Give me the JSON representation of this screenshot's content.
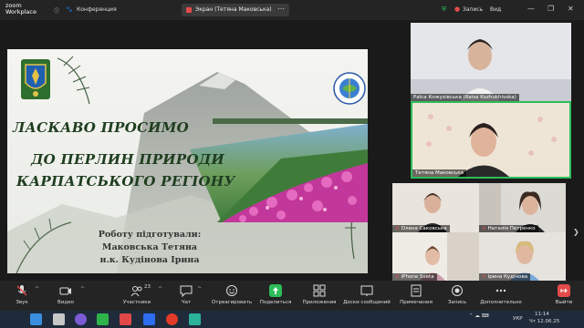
{
  "titlebar": {
    "logo_line1": "zoom",
    "logo_line2": "Workplace",
    "conference_label": "Конференция",
    "share_label": "Экран (Тетяна Маковська)",
    "record_label": "Запись",
    "view_label": "Вид"
  },
  "slide": {
    "title_line1": "ЛАСКАВО ПРОСИМО",
    "title_line2": "ДО ПЕРЛИН ПРИРОДИ",
    "title_line3": "КАРПАТСЬКОГО РЕГІОНУ",
    "prepared_by": "Роботу підготували:",
    "author1": "Маковська Тетяна",
    "author2": "н.к. Кудінова Ірина"
  },
  "participants": [
    {
      "name": "Раїса Кожухівська (Raisa Kozhukhivska)",
      "muted": false
    },
    {
      "name": "Тетяна Маковська",
      "muted": false
    },
    {
      "name": "Олена Саковська",
      "muted": true
    },
    {
      "name": "Наталія Петренко",
      "muted": true
    },
    {
      "name": "iPhone Sveta",
      "muted": true
    },
    {
      "name": "Ірина Кудінова",
      "muted": true
    }
  ],
  "toolbar": {
    "audio": "Звук",
    "video": "Видео",
    "participants": "Участники",
    "participants_count": "23",
    "chat": "Чат",
    "reactions": "Отреагировать",
    "share": "Поделиться",
    "apps": "Приложения",
    "whiteboards": "Доски сообщений",
    "notes": "Примечания",
    "record": "Запись",
    "more": "Дополнительно",
    "leave": "Выйти"
  },
  "taskbar": {
    "time": "11:14",
    "date": "Чт 12.06.25",
    "lang": "УКР"
  },
  "colors": {
    "accent_green": "#2dbd5a",
    "leave_red": "#e34b4b",
    "title_green": "#1f3d1f"
  }
}
